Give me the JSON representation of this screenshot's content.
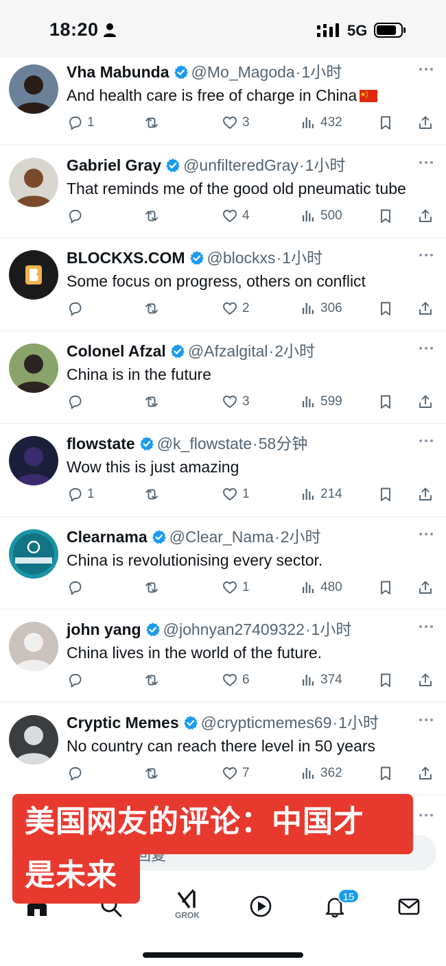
{
  "status_bar": {
    "time": "18:20",
    "network": "5G"
  },
  "tweets": [
    {
      "name": "Vha Mabunda",
      "handle": "@Mo_Magoda",
      "separator": "·",
      "time": "1小时",
      "text": "And health care is free of charge in China",
      "has_flag": true,
      "replies": "1",
      "retweets": "",
      "likes": "3",
      "views": "432",
      "avatar_colors": [
        "#6a8199",
        "#2a1d17"
      ]
    },
    {
      "name": "Gabriel Gray",
      "handle": "@unfilteredGray",
      "separator": "·",
      "time": "1小时",
      "text": "That reminds me of the good old pneumatic tube",
      "replies": "",
      "retweets": "",
      "likes": "4",
      "views": "500",
      "avatar_colors": [
        "#d9d6cf",
        "#7a4a2a"
      ]
    },
    {
      "name": "BLOCKXS.COM",
      "handle": "@blockxs",
      "separator": "·",
      "time": "1小时",
      "text": "Some focus on progress, others on conflict",
      "replies": "",
      "retweets": "",
      "likes": "2",
      "views": "306",
      "avatar_colors": [
        "#1b1b1b",
        "#f2b24a"
      ],
      "avatar_letter": "B"
    },
    {
      "name": "Colonel Afzal",
      "handle": "@Afzalgital",
      "separator": "·",
      "time": "2小时",
      "text": "China is in the future",
      "replies": "",
      "retweets": "",
      "likes": "3",
      "views": "599",
      "avatar_colors": [
        "#8aa36a",
        "#2b2420"
      ]
    },
    {
      "name": "flowstate",
      "handle": "@k_flowstate",
      "separator": "·",
      "time": "58分钟",
      "text": "Wow this is just amazing",
      "replies": "1",
      "retweets": "",
      "likes": "1",
      "views": "214",
      "avatar_colors": [
        "#1c1f3a",
        "#3b2a6e"
      ]
    },
    {
      "name": "Clearnama",
      "handle": "@Clear_Nama",
      "separator": "·",
      "time": "2小时",
      "text": "China is revolutionising every sector.",
      "replies": "",
      "retweets": "",
      "likes": "1",
      "views": "480",
      "avatar_colors": [
        "#1a93a6",
        "#0e5e70"
      ],
      "avatar_text": "CLEAR NAMA"
    },
    {
      "name": "john yang",
      "handle": "@johnyan27409322",
      "separator": "·",
      "time": "1小时",
      "text": "China lives in the world of the future.",
      "replies": "",
      "retweets": "",
      "likes": "6",
      "views": "374",
      "avatar_colors": [
        "#c9c2bd",
        "#f1eeee"
      ]
    },
    {
      "name": "Cryptic Memes",
      "handle": "@crypticmemes69",
      "separator": "·",
      "time": "1小时",
      "text": "No country can reach there level in 50 years",
      "replies": "",
      "retweets": "",
      "likes": "7",
      "views": "362",
      "avatar_colors": [
        "#3a3e40",
        "#d8dcdc"
      ]
    }
  ],
  "reply_bar": {
    "placeholder": "回复"
  },
  "bottom_nav": {
    "grok_label": "GROK",
    "notifications_badge": "15"
  },
  "caption": {
    "line1": "美国网友的评论：中国才",
    "line2": "是未来"
  },
  "colors": {
    "accent": "#1d9bf0",
    "caption_bg": "#e8392f",
    "muted": "#536471"
  }
}
